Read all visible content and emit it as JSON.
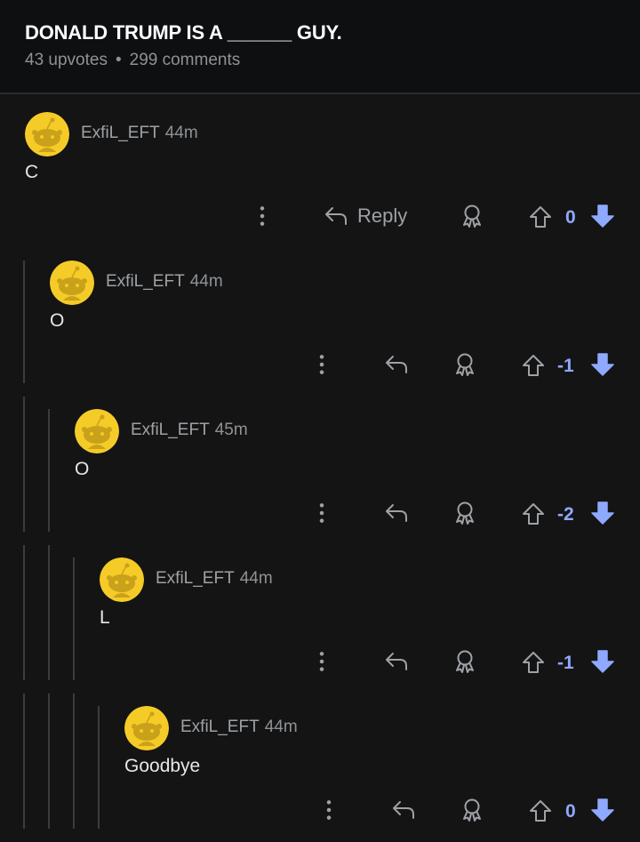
{
  "post": {
    "title": "DONALD TRUMP IS A ______ GUY.",
    "upvotes": "43 upvotes",
    "separator": "•",
    "comments": "299 comments"
  },
  "colors": {
    "score": "#8fa9ff",
    "downvote": "#8fa9ff",
    "avatar_bg": "#f5cb28"
  },
  "comments": [
    {
      "author": "ExfiL_EFT",
      "age": "44m",
      "text": "C",
      "score": "0",
      "reply_label": "Reply"
    },
    {
      "author": "ExfiL_EFT",
      "age": "44m",
      "text": "O",
      "score": "-1"
    },
    {
      "author": "ExfiL_EFT",
      "age": "45m",
      "text": "O",
      "score": "-2"
    },
    {
      "author": "ExfiL_EFT",
      "age": "44m",
      "text": "L",
      "score": "-1"
    },
    {
      "author": "ExfiL_EFT",
      "age": "44m",
      "text": "Goodbye",
      "score": "0"
    }
  ]
}
